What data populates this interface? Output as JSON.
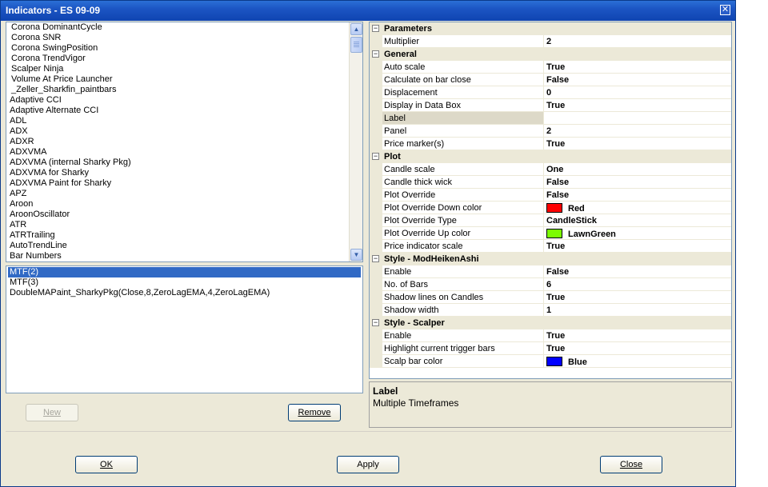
{
  "window": {
    "title": "Indicators - ES 09-09"
  },
  "available_indicators": [
    "Corona DominantCycle",
    "Corona SNR",
    "Corona SwingPosition",
    "Corona TrendVigor",
    "Scalper Ninja",
    "Volume At Price Launcher",
    "_Zeller_Sharkfin_paintbars",
    "Adaptive  CCI",
    "Adaptive Alternate CCI",
    "ADL",
    "ADX",
    "ADXR",
    "ADXVMA",
    "ADXVMA (internal Sharky Pkg)",
    "ADXVMA for Sharky",
    "ADXVMA Paint for Sharky",
    "APZ",
    "Aroon",
    "AroonOscillator",
    "ATR",
    "ATRTrailing",
    "AutoTrendLine",
    "Bar Numbers"
  ],
  "applied_indicators": [
    "MTF(2)",
    "MTF(3)",
    "DoubleMAPaint_SharkyPkg(Close,8,ZeroLagEMA,4,ZeroLagEMA)"
  ],
  "buttons": {
    "new": "New",
    "remove": "Remove",
    "ok": "OK",
    "apply": "Apply",
    "close": "Close"
  },
  "properties": [
    {
      "category": "Parameters",
      "toggle": "⊟",
      "items": [
        {
          "name": "Multiplier",
          "value": "2"
        }
      ]
    },
    {
      "category": "General",
      "toggle": "⊟",
      "items": [
        {
          "name": "Auto scale",
          "value": "True"
        },
        {
          "name": "Calculate on bar close",
          "value": "False"
        },
        {
          "name": "Displacement",
          "value": "0"
        },
        {
          "name": "Display in Data Box",
          "value": "True"
        },
        {
          "name": "Label",
          "value": ""
        },
        {
          "name": "Panel",
          "value": "2"
        },
        {
          "name": "Price marker(s)",
          "value": "True"
        }
      ]
    },
    {
      "category": "Plot",
      "toggle": "⊟",
      "items": [
        {
          "name": "Candle scale",
          "value": "One"
        },
        {
          "name": "Candle thick wick",
          "value": "False"
        },
        {
          "name": "Plot Override",
          "value": "False"
        },
        {
          "name": "Plot Override Down color",
          "value": "Red",
          "color": "#ff0000"
        },
        {
          "name": "Plot Override Type",
          "value": "CandleStick"
        },
        {
          "name": "Plot Override Up color",
          "value": "LawnGreen",
          "color": "#7cfc00"
        },
        {
          "name": "Price indicator scale",
          "value": "True"
        }
      ]
    },
    {
      "category": "Style - ModHeikenAshi",
      "toggle": "⊟",
      "items": [
        {
          "name": "Enable",
          "value": "False"
        },
        {
          "name": "No. of Bars",
          "value": "6"
        },
        {
          "name": "Shadow lines on Candles",
          "value": "True"
        },
        {
          "name": "Shadow width",
          "value": "1"
        }
      ]
    },
    {
      "category": "Style - Scalper",
      "toggle": "⊟",
      "items": [
        {
          "name": "Enable",
          "value": "True"
        },
        {
          "name": "Highlight current trigger bars",
          "value": "True"
        },
        {
          "name": "Scalp bar color",
          "value": "Blue",
          "color": "#0000ff"
        }
      ]
    }
  ],
  "help": {
    "title": "Label",
    "description": "Multiple Timeframes"
  },
  "icons": {
    "close": "close-icon",
    "scroll_up": "scroll-up-icon",
    "scroll_down": "scroll-down-icon"
  },
  "colors": {
    "titlebar": "#1c55c3",
    "selection": "#316ac5",
    "dialog": "#ece9d8"
  }
}
